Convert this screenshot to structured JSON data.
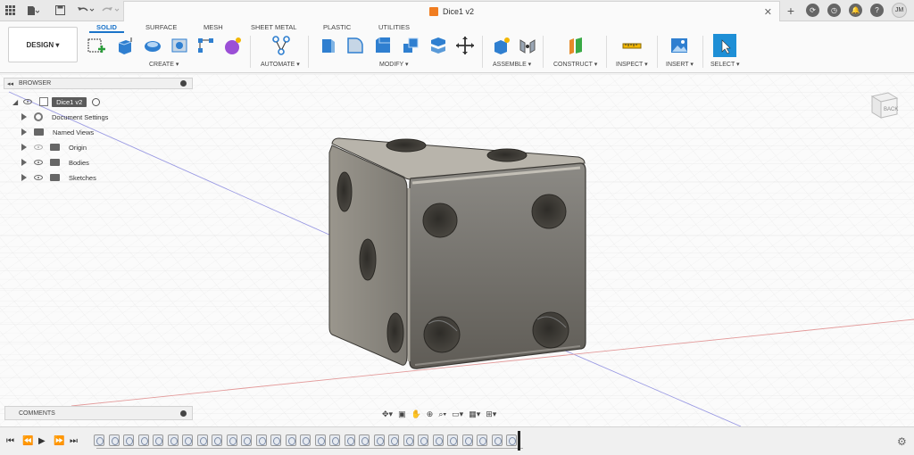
{
  "titlebar": {
    "document_title": "Dice1 v2",
    "user_initials": "JM"
  },
  "ribbon": {
    "workspace": "DESIGN",
    "tabs": [
      "SOLID",
      "SURFACE",
      "MESH",
      "SHEET METAL",
      "PLASTIC",
      "UTILITIES"
    ],
    "active_tab": "SOLID",
    "groups": {
      "create": "CREATE ▾",
      "automate": "AUTOMATE ▾",
      "modify": "MODIFY ▾",
      "assemble": "ASSEMBLE ▾",
      "construct": "CONSTRUCT ▾",
      "inspect": "INSPECT ▾",
      "insert": "INSERT ▾",
      "select": "SELECT ▾"
    }
  },
  "browser": {
    "title": "BROWSER",
    "root": "Dice1 v2",
    "items": [
      "Document Settings",
      "Named Views",
      "Origin",
      "Bodies",
      "Sketches"
    ]
  },
  "comments": {
    "title": "COMMENTS"
  },
  "viewcube": {
    "face_label": "BACK"
  },
  "colors": {
    "accent": "#1a73c9",
    "body_dark": "#6d6a63",
    "body_mid": "#8f8b83",
    "body_light": "#b8b4ab",
    "axis_red": "#e39a9a",
    "axis_blue": "#9a9ae3"
  }
}
